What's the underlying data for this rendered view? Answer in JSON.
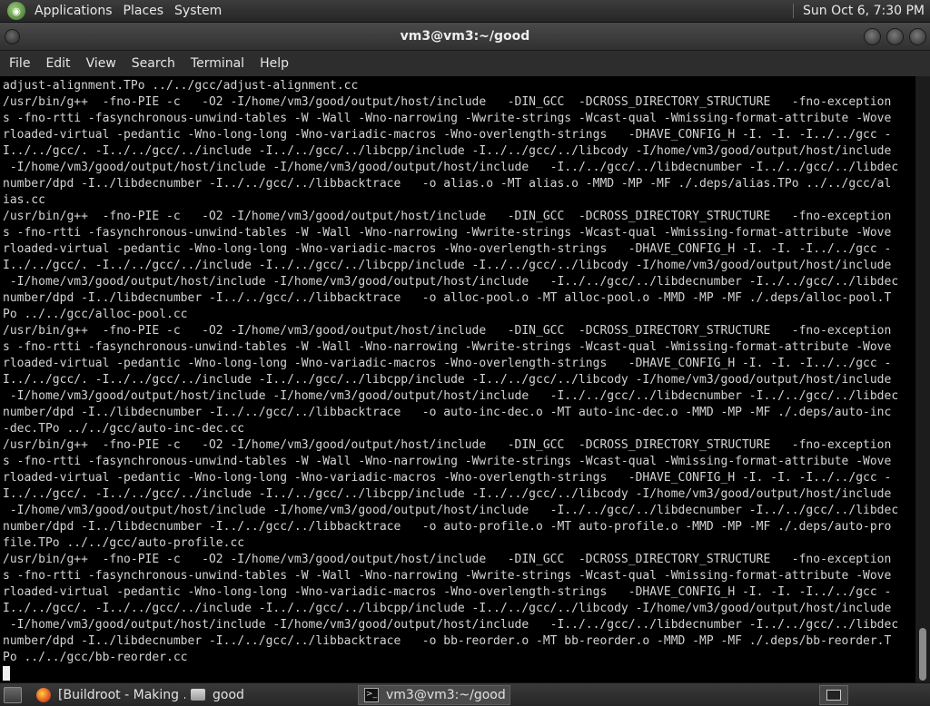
{
  "top_panel": {
    "menus": [
      "Applications",
      "Places",
      "System"
    ],
    "clock": "Sun Oct  6,  7:30 PM"
  },
  "window": {
    "title": "vm3@vm3:~/good"
  },
  "menubar": {
    "items": [
      "File",
      "Edit",
      "View",
      "Search",
      "Terminal",
      "Help"
    ]
  },
  "terminal": {
    "lines": [
      "adjust-alignment.TPo ../../gcc/adjust-alignment.cc",
      "/usr/bin/g++  -fno-PIE -c   -O2 -I/home/vm3/good/output/host/include   -DIN_GCC  -DCROSS_DIRECTORY_STRUCTURE   -fno-exception",
      "s -fno-rtti -fasynchronous-unwind-tables -W -Wall -Wno-narrowing -Wwrite-strings -Wcast-qual -Wmissing-format-attribute -Wove",
      "rloaded-virtual -pedantic -Wno-long-long -Wno-variadic-macros -Wno-overlength-strings   -DHAVE_CONFIG_H -I. -I. -I../../gcc -",
      "I../../gcc/. -I../../gcc/../include -I../../gcc/../libcpp/include -I../../gcc/../libcody -I/home/vm3/good/output/host/include",
      " -I/home/vm3/good/output/host/include -I/home/vm3/good/output/host/include   -I../../gcc/../libdecnumber -I../../gcc/../libdec",
      "number/dpd -I../libdecnumber -I../../gcc/../libbacktrace   -o alias.o -MT alias.o -MMD -MP -MF ./.deps/alias.TPo ../../gcc/al",
      "ias.cc",
      "/usr/bin/g++  -fno-PIE -c   -O2 -I/home/vm3/good/output/host/include   -DIN_GCC  -DCROSS_DIRECTORY_STRUCTURE   -fno-exception",
      "s -fno-rtti -fasynchronous-unwind-tables -W -Wall -Wno-narrowing -Wwrite-strings -Wcast-qual -Wmissing-format-attribute -Wove",
      "rloaded-virtual -pedantic -Wno-long-long -Wno-variadic-macros -Wno-overlength-strings   -DHAVE_CONFIG_H -I. -I. -I../../gcc -",
      "I../../gcc/. -I../../gcc/../include -I../../gcc/../libcpp/include -I../../gcc/../libcody -I/home/vm3/good/output/host/include",
      " -I/home/vm3/good/output/host/include -I/home/vm3/good/output/host/include   -I../../gcc/../libdecnumber -I../../gcc/../libdec",
      "number/dpd -I../libdecnumber -I../../gcc/../libbacktrace   -o alloc-pool.o -MT alloc-pool.o -MMD -MP -MF ./.deps/alloc-pool.T",
      "Po ../../gcc/alloc-pool.cc",
      "/usr/bin/g++  -fno-PIE -c   -O2 -I/home/vm3/good/output/host/include   -DIN_GCC  -DCROSS_DIRECTORY_STRUCTURE   -fno-exception",
      "s -fno-rtti -fasynchronous-unwind-tables -W -Wall -Wno-narrowing -Wwrite-strings -Wcast-qual -Wmissing-format-attribute -Wove",
      "rloaded-virtual -pedantic -Wno-long-long -Wno-variadic-macros -Wno-overlength-strings   -DHAVE_CONFIG_H -I. -I. -I../../gcc -",
      "I../../gcc/. -I../../gcc/../include -I../../gcc/../libcpp/include -I../../gcc/../libcody -I/home/vm3/good/output/host/include",
      " -I/home/vm3/good/output/host/include -I/home/vm3/good/output/host/include   -I../../gcc/../libdecnumber -I../../gcc/../libdec",
      "number/dpd -I../libdecnumber -I../../gcc/../libbacktrace   -o auto-inc-dec.o -MT auto-inc-dec.o -MMD -MP -MF ./.deps/auto-inc",
      "-dec.TPo ../../gcc/auto-inc-dec.cc",
      "/usr/bin/g++  -fno-PIE -c   -O2 -I/home/vm3/good/output/host/include   -DIN_GCC  -DCROSS_DIRECTORY_STRUCTURE   -fno-exception",
      "s -fno-rtti -fasynchronous-unwind-tables -W -Wall -Wno-narrowing -Wwrite-strings -Wcast-qual -Wmissing-format-attribute -Wove",
      "rloaded-virtual -pedantic -Wno-long-long -Wno-variadic-macros -Wno-overlength-strings   -DHAVE_CONFIG_H -I. -I. -I../../gcc -",
      "I../../gcc/. -I../../gcc/../include -I../../gcc/../libcpp/include -I../../gcc/../libcody -I/home/vm3/good/output/host/include",
      " -I/home/vm3/good/output/host/include -I/home/vm3/good/output/host/include   -I../../gcc/../libdecnumber -I../../gcc/../libdec",
      "number/dpd -I../libdecnumber -I../../gcc/../libbacktrace   -o auto-profile.o -MT auto-profile.o -MMD -MP -MF ./.deps/auto-pro",
      "file.TPo ../../gcc/auto-profile.cc",
      "/usr/bin/g++  -fno-PIE -c   -O2 -I/home/vm3/good/output/host/include   -DIN_GCC  -DCROSS_DIRECTORY_STRUCTURE   -fno-exception",
      "s -fno-rtti -fasynchronous-unwind-tables -W -Wall -Wno-narrowing -Wwrite-strings -Wcast-qual -Wmissing-format-attribute -Wove",
      "rloaded-virtual -pedantic -Wno-long-long -Wno-variadic-macros -Wno-overlength-strings   -DHAVE_CONFIG_H -I. -I. -I../../gcc -",
      "I../../gcc/. -I../../gcc/../include -I../../gcc/../libcpp/include -I../../gcc/../libcody -I/home/vm3/good/output/host/include",
      " -I/home/vm3/good/output/host/include -I/home/vm3/good/output/host/include   -I../../gcc/../libdecnumber -I../../gcc/../libdec",
      "number/dpd -I../libdecnumber -I../../gcc/../libbacktrace   -o bb-reorder.o -MT bb-reorder.o -MMD -MP -MF ./.deps/bb-reorder.T",
      "Po ../../gcc/bb-reorder.cc"
    ]
  },
  "taskbar": {
    "tasks": [
      {
        "label": "[Buildroot - Making ...",
        "icon": "firefox-icon"
      },
      {
        "label": "good",
        "icon": "folder-icon"
      },
      {
        "label": "vm3@vm3:~/good",
        "icon": "terminal-icon",
        "active": true
      }
    ]
  }
}
